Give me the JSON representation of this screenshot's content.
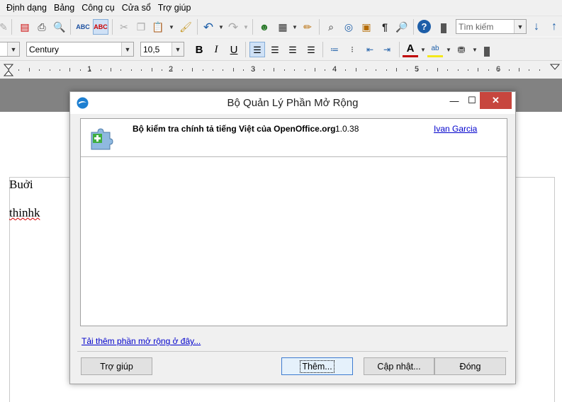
{
  "menubar": {
    "items": [
      "Định dạng",
      "Bảng",
      "Công cụ",
      "Cửa sổ",
      "Trợ giúp"
    ]
  },
  "toolbar": {
    "search": {
      "value": "Tìm kiếm"
    },
    "font_name": "Century",
    "font_size": "10,5"
  },
  "ruler": {
    "numbers": [
      "1",
      "2",
      "3",
      "4",
      "5",
      "6"
    ]
  },
  "document": {
    "lines": [
      "Buởi",
      "thinhk"
    ]
  },
  "dialog": {
    "title": "Bộ Quản Lý Phần Mở Rộng",
    "extensions": [
      {
        "name": "Bộ kiểm tra chính tả tiếng Việt của OpenOffice.org",
        "version": "1.0.38",
        "publisher": "Ivan Garcia",
        "icon": "puzzle-plus-icon"
      }
    ],
    "more_link": "Tải thêm phần mở rộng ở đây...",
    "buttons": {
      "help": "Trợ giúp",
      "add": "Thêm...",
      "update": "Cập nhật...",
      "close": "Đóng"
    }
  },
  "colors": {
    "font_color": "#c00000",
    "highlight": "#f4e81a",
    "close_button": "#c7463e",
    "link": "#0000cc"
  }
}
